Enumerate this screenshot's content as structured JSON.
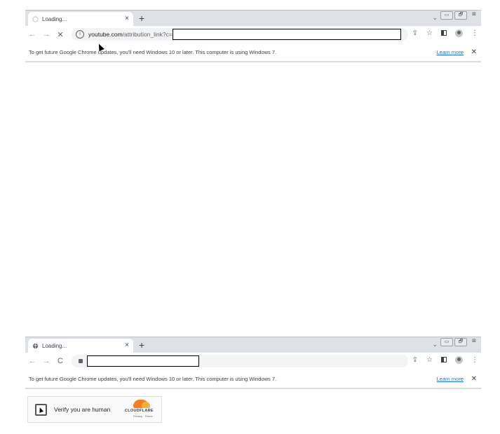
{
  "windows": [
    {
      "tab": {
        "title": "Loading...",
        "close_label": "×"
      },
      "new_tab_label": "+",
      "tab_menu_label": "⌄",
      "window_controls": {
        "minimize": "▭",
        "restore": "🗗",
        "close": "⊠"
      },
      "nav": {
        "back": "←",
        "forward": "→",
        "reload_or_stop": "✕"
      },
      "omnibox": {
        "host": "youtube.com",
        "path": "/attribution_link?c="
      },
      "tools": {
        "share": "⇪",
        "star": "☆",
        "menu": "⋮"
      },
      "infobar": {
        "message": "To get future Google Chrome updates, you'll need Windows 10 or later. This computer is using Windows 7.",
        "learn_more": "Learn more",
        "close": "✕"
      }
    },
    {
      "tab": {
        "title": "Loading...",
        "close_label": "×"
      },
      "new_tab_label": "+",
      "tab_menu_label": "⌄",
      "window_controls": {
        "minimize": "▭",
        "restore": "🗗",
        "close": "⊠"
      },
      "nav": {
        "back": "←",
        "forward": "→",
        "reload_or_stop": "C"
      },
      "omnibox": {
        "host": "",
        "path": ""
      },
      "tools": {
        "share": "⇪",
        "star": "☆",
        "menu": "⋮"
      },
      "infobar": {
        "message": "To get future Google Chrome updates, you'll need Windows 10 or later. This computer is using Windows 7.",
        "learn_more": "Learn more",
        "close": "✕"
      }
    }
  ],
  "turnstile": {
    "label": "Verify you are human",
    "brand": "CLOUDFLARE",
    "links": "Privacy · Terms"
  },
  "colors": {
    "accent": "#1a73e8",
    "cloudflare_orange": "#f48120"
  }
}
